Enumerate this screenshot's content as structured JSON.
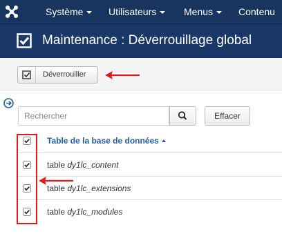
{
  "nav": {
    "items": [
      {
        "label": "Système"
      },
      {
        "label": "Utilisateurs"
      },
      {
        "label": "Menus"
      },
      {
        "label": "Contenu"
      }
    ]
  },
  "header": {
    "title": "Maintenance : Déverrouillage global",
    "icon": "checkbox-checked-icon"
  },
  "toolbar": {
    "unlock_label": "Déverrouiller",
    "icon": "checkbox-checked-icon"
  },
  "search": {
    "placeholder": "Rechercher",
    "value": "",
    "clear_label": "Effacer"
  },
  "table": {
    "header": "Table de la base de données",
    "rows": [
      {
        "prefix": "table",
        "name": "dy1lc_content",
        "checked": true
      },
      {
        "prefix": "table",
        "name": "dy1lc_extensions",
        "checked": true
      },
      {
        "prefix": "table",
        "name": "dy1lc_modules",
        "checked": true
      }
    ]
  },
  "colors": {
    "nav_bg": "#17355e",
    "title_bg": "#1a3867",
    "link": "#1f5b9f",
    "annotation": "#e01a1a"
  }
}
